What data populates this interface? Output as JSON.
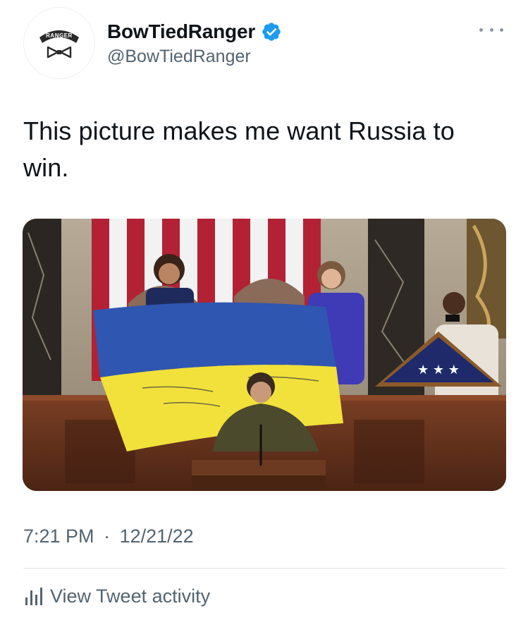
{
  "user": {
    "display_name": "BowTiedRanger",
    "handle": "@BowTiedRanger",
    "verified": true,
    "avatar_tab_text": "RANGER",
    "avatar_icon": "bowtie-icon"
  },
  "tweet": {
    "text": "This picture makes me want Russia to win.",
    "media_description_icon": "photo",
    "time": "7:21 PM",
    "separator": "·",
    "date": "12/21/22"
  },
  "actions": {
    "more_icon": "more-horizontal-icon",
    "activity_label": "View Tweet activity",
    "activity_icon": "bar-chart-icon"
  },
  "colors": {
    "text_primary": "#0f1419",
    "text_secondary": "#536471",
    "verified_blue": "#1d9bf0",
    "divider": "#e1e6ea"
  }
}
